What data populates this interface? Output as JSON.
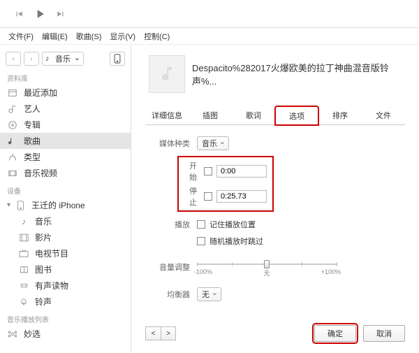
{
  "topbar": {
    "prev": "prev",
    "play": "play",
    "next": "next"
  },
  "menu": {
    "file": "文件(F)",
    "edit": "编辑(E)",
    "songs": "歌曲(S)",
    "view": "显示(V)",
    "control": "控制(C)"
  },
  "nav": {
    "back": "‹",
    "fwd": "›",
    "drop_label": "音乐"
  },
  "groups": {
    "library": "资料库",
    "devices": "设备",
    "playlists": "音乐播放列表"
  },
  "lib": {
    "recent": "最近添加",
    "artists": "艺人",
    "albums": "专辑",
    "songs": "歌曲",
    "genres": "类型",
    "musicvideos": "音乐视频"
  },
  "dev": {
    "name": "王迁的 iPhone",
    "music": "音乐",
    "movies": "影片",
    "tv": "电视节目",
    "books": "图书",
    "audiobooks": "有声读物",
    "ringtones": "铃声"
  },
  "pl": {
    "miao": "妙选"
  },
  "dialog": {
    "title": "Despacito%282017火爆欧美的拉丁神曲混音版铃声%...",
    "tabs": {
      "info": "详细信息",
      "art": "插图",
      "lyrics": "歌词",
      "options": "选项",
      "sort": "排序",
      "file": "文件"
    },
    "labels": {
      "media": "媒体种类",
      "start": "开始",
      "stop": "停止",
      "play": "播放",
      "volume": "音量调整",
      "eq": "均衡器"
    },
    "values": {
      "media": "音乐",
      "start": "0:00",
      "stop": "0:25.73",
      "remember": "记住播放位置",
      "shuffle": "随机播放时跳过",
      "eq": "无"
    },
    "slider": {
      "left": "-100%",
      "mid": "无",
      "right": "+100%"
    },
    "buttons": {
      "ok": "确定",
      "cancel": "取消"
    }
  }
}
